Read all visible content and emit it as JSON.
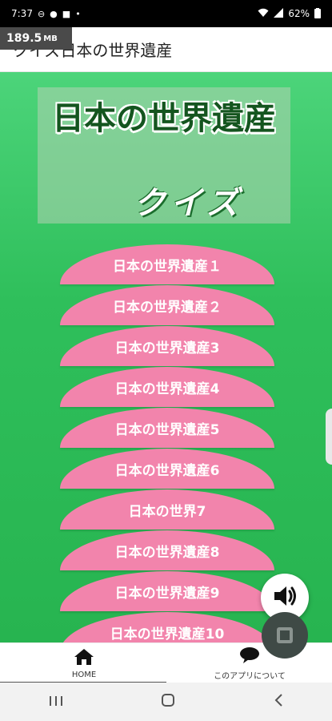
{
  "status_bar": {
    "time": "7:37",
    "battery": "62%",
    "icons": [
      "minus-circle-icon",
      "account-circle-icon",
      "briefcase-icon",
      "dot-icon",
      "wifi-icon",
      "signal-icon",
      "battery-icon"
    ]
  },
  "memory_badge": {
    "value": "189.5",
    "unit": "MB"
  },
  "app_bar": {
    "title": "クイズ日本の世界遺産"
  },
  "header": {
    "title_line1": "日本の世界遺産",
    "title_line2": "クイズ"
  },
  "quiz_buttons": [
    "日本の世界遺産１",
    "日本の世界遺産２",
    "日本の世界遺産3",
    "日本の世界遺産4",
    "日本の世界遺産5",
    "日本の世界遺産6",
    "日本の世界7",
    "日本の世界遺産8",
    "日本の世界遺産9",
    "日本の世界遺産10"
  ],
  "bottom_nav": {
    "home_label": "HOME",
    "about_label": "このアプリについて"
  },
  "colors": {
    "accent_pink": "#f284ac",
    "green": "#2fbf5b",
    "title_green": "#14551f"
  }
}
